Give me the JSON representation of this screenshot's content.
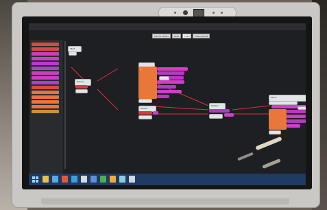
{
  "app": {
    "title": "",
    "toolbar": {
      "buttons": [
        "Device Status",
        "Save",
        "Load",
        "Debug Mode"
      ],
      "selected_index": 2
    }
  },
  "palette": {
    "items": [
      {
        "label": "",
        "color": "#d24b4b"
      },
      {
        "label": "",
        "color": "#d24b4b"
      },
      {
        "label": "",
        "color": "#c93fc4"
      },
      {
        "label": "",
        "color": "#c93fc4"
      },
      {
        "label": "",
        "color": "#b13dcc"
      },
      {
        "label": "",
        "color": "#b13dcc"
      },
      {
        "label": "",
        "color": "#c93fc4"
      },
      {
        "label": "",
        "color": "#c93fc4"
      },
      {
        "label": "",
        "color": "#b13dcc"
      },
      {
        "label": "",
        "color": "#d24b4b"
      },
      {
        "label": "",
        "color": "#e9753b"
      },
      {
        "label": "",
        "color": "#e9753b"
      },
      {
        "label": "",
        "color": "#e9753b"
      },
      {
        "label": "",
        "color": "#e9753b"
      },
      {
        "label": "",
        "color": "#c8923a"
      }
    ]
  },
  "workspace": {
    "nodes": [
      {
        "id": "start",
        "kind": "white",
        "label": "Start"
      },
      {
        "id": "device1",
        "kind": "white",
        "label": "Device"
      },
      {
        "id": "logic1",
        "kind": "orange",
        "label": "If"
      },
      {
        "id": "logic2",
        "kind": "white",
        "label": "Sensor"
      },
      {
        "id": "merge",
        "kind": "white",
        "label": "Output"
      },
      {
        "id": "logic3",
        "kind": "white",
        "label": "Servo"
      }
    ]
  },
  "taskbar": {
    "icons": [
      {
        "name": "start-icon",
        "color": "#9ad2ff"
      },
      {
        "name": "explorer-icon",
        "color": "#e7c04d"
      },
      {
        "name": "ie-icon",
        "color": "#5aa8e8"
      },
      {
        "name": "app-icon",
        "color": "#e05a3a"
      },
      {
        "name": "app-icon-2",
        "color": "#3aa0d8"
      },
      {
        "name": "app-icon-3",
        "color": "#d9d9d9"
      },
      {
        "name": "app-icon-4",
        "color": "#5b8fd6"
      },
      {
        "name": "app-icon-5",
        "color": "#4caf50"
      },
      {
        "name": "app-icon-6",
        "color": "#f2a93b"
      },
      {
        "name": "app-icon-7",
        "color": "#8ecae6"
      },
      {
        "name": "app-icon-8",
        "color": "#cfd8e6"
      }
    ],
    "tray_text": "",
    "clock": "",
    "date": ""
  },
  "colors": {
    "accent_orange": "#e9763a",
    "accent_purple": "#b43bbd",
    "wire": "#e2303b",
    "taskbar": "#1f3a63"
  }
}
